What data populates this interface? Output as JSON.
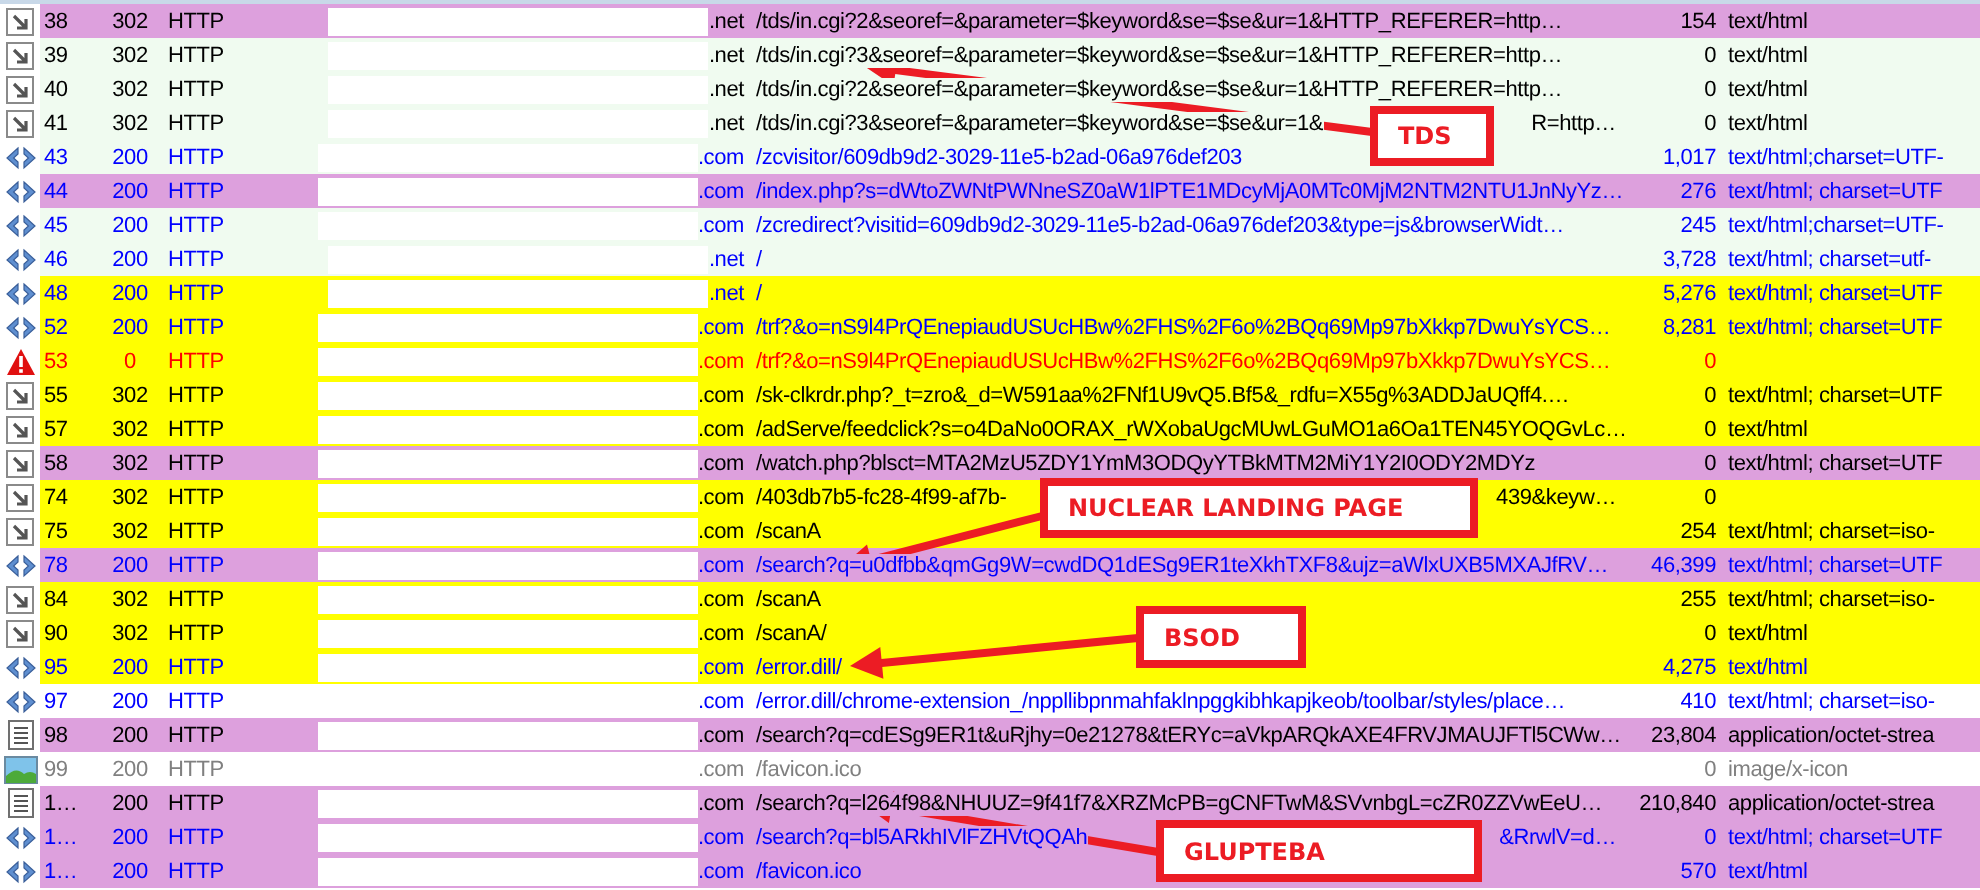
{
  "sessions": [
    {
      "kind": "redirect",
      "number": "38",
      "result": "302",
      "protocol": "HTTP",
      "host": ".net",
      "url": "/tds/in.cgi?2&seoref=&parameter=$keyword&se=$se&ur=1&HTTP_REFERER=http…",
      "body": "154",
      "content_type": "text/html",
      "color": "#dda0dd"
    },
    {
      "kind": "redirect",
      "number": "39",
      "result": "302",
      "protocol": "HTTP",
      "host": ".net",
      "url": "/tds/in.cgi?3&seoref=&parameter=$keyword&se=$se&ur=1&HTTP_REFERER=http…",
      "body": "0",
      "content_type": "text/html",
      "color": "#f0fbf0"
    },
    {
      "kind": "redirect",
      "number": "40",
      "result": "302",
      "protocol": "HTTP",
      "host": ".net",
      "url": "/tds/in.cgi?2&seoref=&parameter=$keyword&se=$se&ur=1&HTTP_REFERER=http…",
      "body": "0",
      "content_type": "text/html",
      "color": "#f0fbf0"
    },
    {
      "kind": "redirect",
      "number": "41",
      "result": "302",
      "protocol": "HTTP",
      "host": ".net",
      "url": "/tds/in.cgi?3&seoref=&parameter=$keyword&se=$se&ur=1&",
      "url_tail": "R=http…",
      "body": "0",
      "content_type": "text/html",
      "color": "#f0fbf0"
    },
    {
      "kind": "html",
      "number": "43",
      "result": "200",
      "protocol": "HTTP",
      "host": ".com",
      "url": "/zcvisitor/609db9d2-3029-11e5-b2ad-06a976def203",
      "body": "1,017",
      "content_type": "text/html;charset=UTF-",
      "color": "#f0fbf0"
    },
    {
      "kind": "html",
      "number": "44",
      "result": "200",
      "protocol": "HTTP",
      "host": ".com",
      "url": "/index.php?s=dWtoZWNtPWNneSZ0aW1lPTE1MDcyMjA0MTc0MjM2NTM2NTU1JnNyYz…",
      "body": "276",
      "content_type": "text/html; charset=UTF",
      "color": "#dda0dd"
    },
    {
      "kind": "html",
      "number": "45",
      "result": "200",
      "protocol": "HTTP",
      "host": ".com",
      "url": "/zcredirect?visitid=609db9d2-3029-11e5-b2ad-06a976def203&type=js&browserWidt…",
      "body": "245",
      "content_type": "text/html;charset=UTF-",
      "color": "#f0fbf0"
    },
    {
      "kind": "html",
      "number": "46",
      "result": "200",
      "protocol": "HTTP",
      "host": ".net",
      "url": "/",
      "body": "3,728",
      "content_type": "text/html; charset=utf-",
      "color": "#f0fbf0"
    },
    {
      "kind": "html",
      "number": "48",
      "result": "200",
      "protocol": "HTTP",
      "host": ".net",
      "url": "/",
      "body": "5,276",
      "content_type": "text/html; charset=UTF",
      "color": "#ffff00"
    },
    {
      "kind": "html",
      "number": "52",
      "result": "200",
      "protocol": "HTTP",
      "host": ".com",
      "url": "/trf?&o=nS9l4PrQEnepiaudUSUcHBw%2FHS%2F6o%2BQq69Mp97bXkkp7DwuYsYCS…",
      "body": "8,281",
      "content_type": "text/html; charset=UTF",
      "color": "#ffff00"
    },
    {
      "kind": "error",
      "number": "53",
      "result": "0",
      "protocol": "HTTP",
      "host": ".com",
      "url": "/trf?&o=nS9l4PrQEnepiaudUSUcHBw%2FHS%2F6o%2BQq69Mp97bXkkp7DwuYsYCS…",
      "body": "0",
      "color": "#ffff00"
    },
    {
      "kind": "redirect",
      "number": "55",
      "result": "302",
      "protocol": "HTTP",
      "host": ".com",
      "url": "/sk-clkrdr.php?_t=zro&_d=W591aa%2FNf1U9vQ5.Bf5&_rdfu=X55g%3ADDJaUQff4.…",
      "body": "0",
      "content_type": "text/html; charset=UTF",
      "color": "#ffff00"
    },
    {
      "kind": "redirect",
      "number": "57",
      "result": "302",
      "protocol": "HTTP",
      "host": ".com",
      "url": "/adServe/feedclick?s=o4DaNo0ORAX_rWXobaUgcMUwLGuMO1a6Oa1TEN45YOQGvLc…",
      "body": "0",
      "content_type": "text/html",
      "color": "#ffff00"
    },
    {
      "kind": "redirect",
      "number": "58",
      "result": "302",
      "protocol": "HTTP",
      "host": ".com",
      "url": "/watch.php?blsct=MTA2MzU5ZDY1YmM3ODQyYTBkMTM2MiY1Y2I0ODY2MDYz",
      "body": "0",
      "content_type": "text/html; charset=UTF",
      "color": "#dda0dd"
    },
    {
      "kind": "redirect",
      "number": "74",
      "result": "302",
      "protocol": "HTTP",
      "host": ".com",
      "url": "/403db7b5-fc28-4f99-af7b-",
      "url_tail": "439&keyw…",
      "body": "0",
      "color": "#ffff00"
    },
    {
      "kind": "redirect",
      "number": "75",
      "result": "302",
      "protocol": "HTTP",
      "host": ".com",
      "url": "/scanA",
      "body": "254",
      "content_type": "text/html; charset=iso-",
      "color": "#ffff00"
    },
    {
      "kind": "html",
      "number": "78",
      "result": "200",
      "protocol": "HTTP",
      "host": ".com",
      "url": "/search?q=u0dfbb&qmGg9W=cwdDQ1dESg9ER1teXkhTXF8&ujz=aWlxUXB5MXAJfRV…",
      "body": "46,399",
      "content_type": "text/html; charset=UTF",
      "color": "#dda0dd"
    },
    {
      "kind": "redirect",
      "number": "84",
      "result": "302",
      "protocol": "HTTP",
      "host": ".com",
      "url": "/scanA",
      "body": "255",
      "content_type": "text/html; charset=iso-",
      "color": "#ffff00"
    },
    {
      "kind": "redirect",
      "number": "90",
      "result": "302",
      "protocol": "HTTP",
      "host": ".com",
      "url": "/scanA/",
      "body": "0",
      "content_type": "text/html",
      "color": "#ffff00"
    },
    {
      "kind": "html",
      "number": "95",
      "result": "200",
      "protocol": "HTTP",
      "host": ".com",
      "url": "/error.dill/",
      "body": "4,275",
      "content_type": "text/html",
      "color": "#ffff00"
    },
    {
      "kind": "html",
      "number": "97",
      "result": "200",
      "protocol": "HTTP",
      "host": ".com",
      "url": "/error.dill/chrome-extension_/nppllibpnmahfaklnpggkibhkapjkeob/toolbar/styles/place…",
      "body": "410",
      "content_type": "text/html; charset=iso-",
      "color": "#ffffff"
    },
    {
      "kind": "document",
      "number": "98",
      "result": "200",
      "protocol": "HTTP",
      "host": ".com",
      "url": "/search?q=cdESg9ER1t&uRjhy=0e21278&tERYc=aVkpARQkAXE4FRVJMAUJFTl5CWw…",
      "body": "23,804",
      "content_type": "application/octet-strea",
      "color": "#dda0dd"
    },
    {
      "kind": "image",
      "number": "99",
      "result": "200",
      "protocol": "HTTP",
      "host": ".com",
      "url": "/favicon.ico",
      "body": "0",
      "content_type": "image/x-icon",
      "color": "#ffffff"
    },
    {
      "kind": "document",
      "number": "1…",
      "result": "200",
      "protocol": "HTTP",
      "host": ".com",
      "url": "/search?q=l264f98&NHUUZ=9f41f7&XRZMcPB=gCNFTwM&SVvnbgL=cZR0ZZVwEeU…",
      "body": "210,840",
      "content_type": "application/octet-strea",
      "color": "#dda0dd"
    },
    {
      "kind": "html",
      "number": "1…",
      "result": "200",
      "protocol": "HTTP",
      "host": ".com",
      "url": "/search?q=bl5ARkhIVlFZHVtQQAh",
      "url_tail": "&RrwlV=d…",
      "body": "0",
      "content_type": "text/html; charset=UTF",
      "color": "#dda0dd"
    },
    {
      "kind": "html",
      "number": "1…",
      "result": "200",
      "protocol": "HTTP",
      "host": ".com",
      "url": "/favicon.ico",
      "body": "570",
      "content_type": "text/html",
      "color": "#dda0dd"
    }
  ],
  "annotations": [
    {
      "label": "TDS"
    },
    {
      "label": "NUCLEAR LANDING PAGE"
    },
    {
      "label": "BSOD"
    },
    {
      "label": "GLUPTEBA"
    }
  ]
}
